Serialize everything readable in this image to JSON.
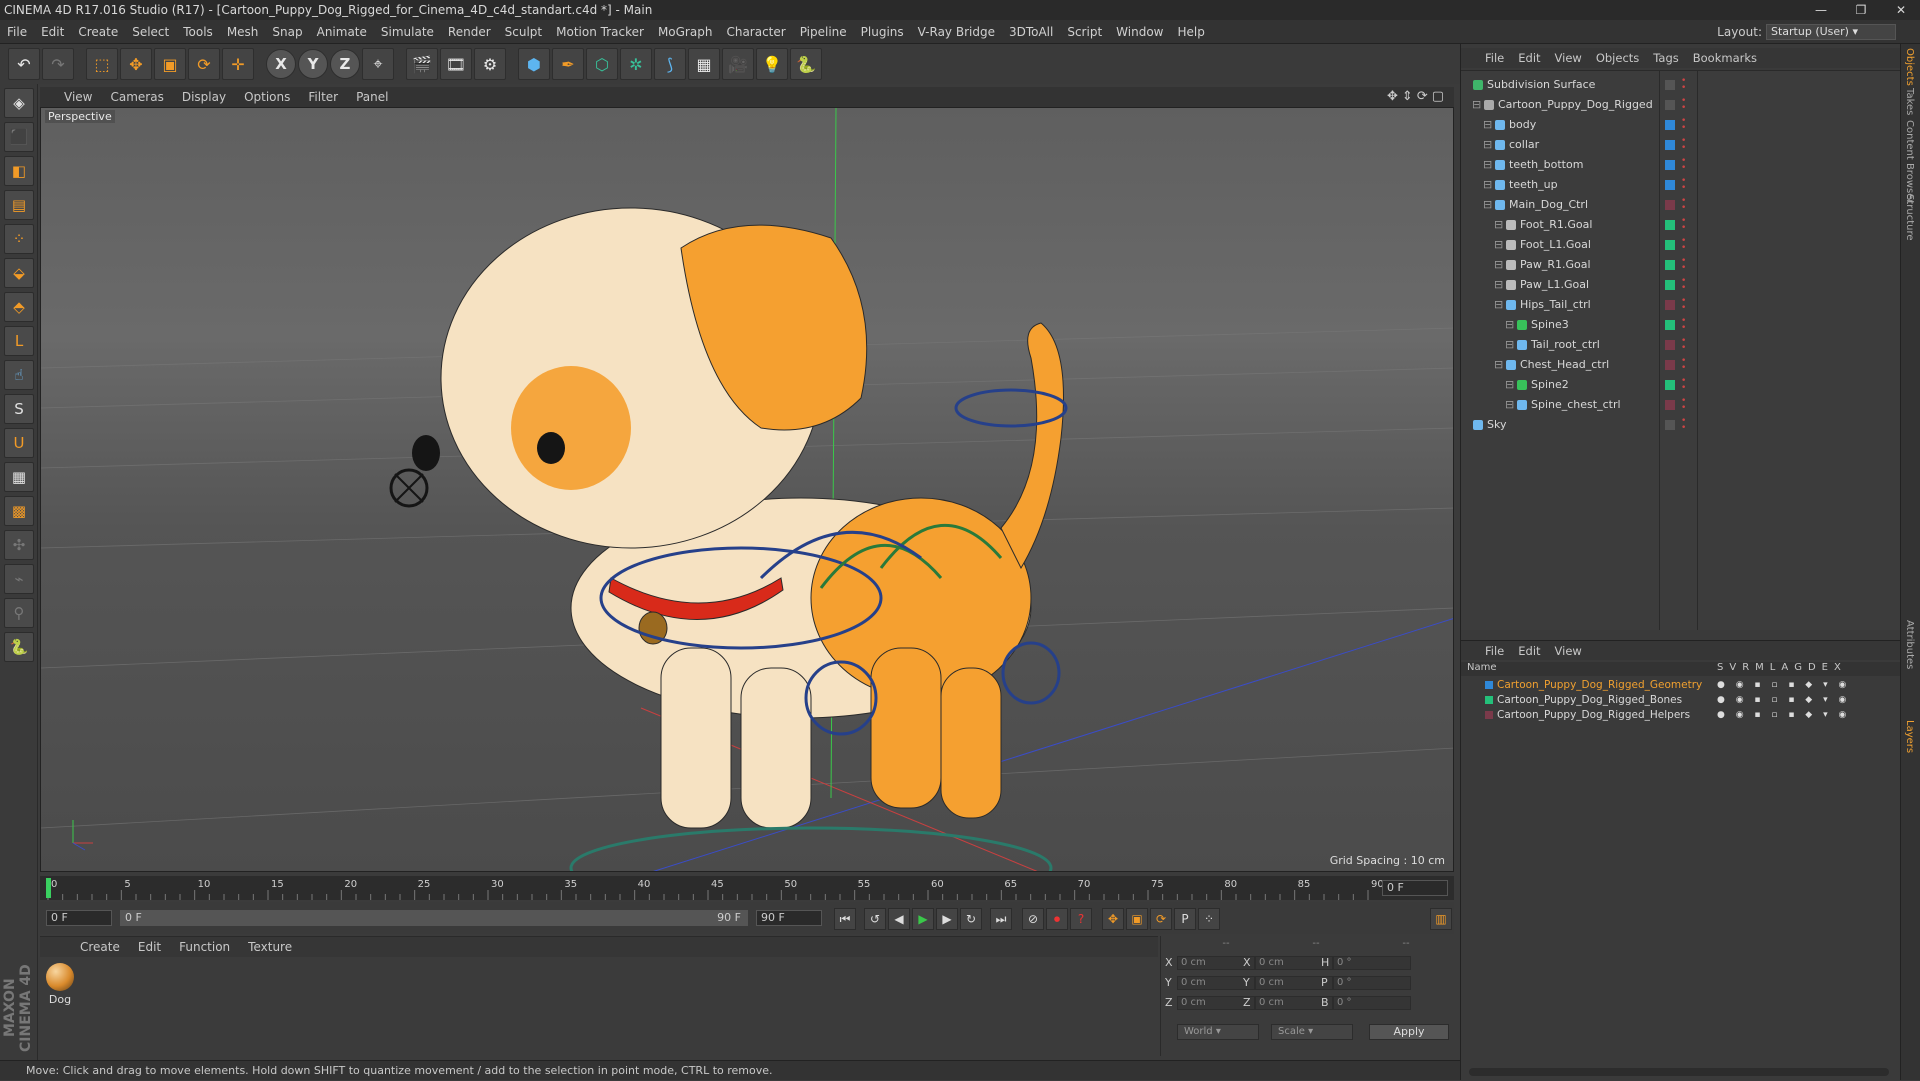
{
  "window": {
    "title": "CINEMA 4D R17.016 Studio (R17) - [Cartoon_Puppy_Dog_Rigged_for_Cinema_4D_c4d_standart.c4d *] - Main"
  },
  "menu": [
    "File",
    "Edit",
    "Create",
    "Select",
    "Tools",
    "Mesh",
    "Snap",
    "Animate",
    "Simulate",
    "Render",
    "Sculpt",
    "Motion Tracker",
    "MoGraph",
    "Character",
    "Pipeline",
    "Plugins",
    "V-Ray Bridge",
    "3DToAll",
    "Script",
    "Window",
    "Help"
  ],
  "layout": {
    "label": "Layout:",
    "value": "Startup (User)"
  },
  "viewport": {
    "menu": [
      "View",
      "Cameras",
      "Display",
      "Options",
      "Filter",
      "Panel"
    ],
    "camera_label": "Perspective",
    "grid_spacing": "Grid Spacing : 10 cm"
  },
  "timeline": {
    "ticks": [
      "0",
      "5",
      "10",
      "15",
      "20",
      "25",
      "30",
      "35",
      "40",
      "45",
      "50",
      "55",
      "60",
      "65",
      "70",
      "75",
      "80",
      "85",
      "90"
    ],
    "current_frame": "0 F",
    "start_frame": "0 F",
    "range_start": "0 F",
    "range_end": "90 F",
    "end_frame": "90 F"
  },
  "material_panel": {
    "menu": [
      "Create",
      "Edit",
      "Function",
      "Texture"
    ],
    "material_name": "Dog"
  },
  "coordinates": {
    "header": [
      "--",
      "--",
      "--"
    ],
    "rows": [
      {
        "a": "X",
        "av": "0 cm",
        "b": "X",
        "bv": "0 cm",
        "c": "H",
        "cv": "0 °"
      },
      {
        "a": "Y",
        "av": "0 cm",
        "b": "Y",
        "bv": "0 cm",
        "c": "P",
        "cv": "0 °"
      },
      {
        "a": "Z",
        "av": "0 cm",
        "b": "Z",
        "bv": "0 cm",
        "c": "B",
        "cv": "0 °"
      }
    ],
    "mode": "World",
    "scale": "Scale",
    "apply": "Apply"
  },
  "status": "Move: Click and drag to move elements. Hold down SHIFT to quantize movement / add to the selection in point mode, CTRL to remove.",
  "object_manager": {
    "menu": [
      "File",
      "Edit",
      "View",
      "Objects",
      "Tags",
      "Bookmarks"
    ],
    "objects": [
      {
        "name": "Subdivision Surface",
        "indent": 0,
        "icon": "#3fb56a",
        "layer": ""
      },
      {
        "name": "Cartoon_Puppy_Dog_Rigged",
        "indent": 1,
        "icon": "#aaaaaa",
        "layer": ""
      },
      {
        "name": "body",
        "indent": 2,
        "icon": "#6fb8ee",
        "layer": "#2f88d8"
      },
      {
        "name": "collar",
        "indent": 2,
        "icon": "#6fb8ee",
        "layer": "#2f88d8"
      },
      {
        "name": "teeth_bottom",
        "indent": 2,
        "icon": "#6fb8ee",
        "layer": "#2f88d8"
      },
      {
        "name": "teeth_up",
        "indent": 2,
        "icon": "#6fb8ee",
        "layer": "#2f88d8"
      },
      {
        "name": "Main_Dog_Ctrl",
        "indent": 2,
        "icon": "#6fb8ee",
        "layer": "#7a3a4a"
      },
      {
        "name": "Foot_R1.Goal",
        "indent": 3,
        "icon": "#bbbbbb",
        "layer": "#24c07a"
      },
      {
        "name": "Foot_L1.Goal",
        "indent": 3,
        "icon": "#bbbbbb",
        "layer": "#24c07a"
      },
      {
        "name": "Paw_R1.Goal",
        "indent": 3,
        "icon": "#bbbbbb",
        "layer": "#24c07a"
      },
      {
        "name": "Paw_L1.Goal",
        "indent": 3,
        "icon": "#bbbbbb",
        "layer": "#24c07a"
      },
      {
        "name": "Hips_Tail_ctrl",
        "indent": 3,
        "icon": "#6fb8ee",
        "layer": "#7a3a4a"
      },
      {
        "name": "Spine3",
        "indent": 4,
        "icon": "#38c25a",
        "layer": "#24c07a"
      },
      {
        "name": "Tail_root_ctrl",
        "indent": 4,
        "icon": "#6fb8ee",
        "layer": "#7a3a4a"
      },
      {
        "name": "Chest_Head_ctrl",
        "indent": 3,
        "icon": "#6fb8ee",
        "layer": "#7a3a4a"
      },
      {
        "name": "Spine2",
        "indent": 4,
        "icon": "#38c25a",
        "layer": "#24c07a"
      },
      {
        "name": "Spine_chest_ctrl",
        "indent": 4,
        "icon": "#6fb8ee",
        "layer": "#7a3a4a"
      },
      {
        "name": "Sky",
        "indent": 0,
        "icon": "#6fb8ee",
        "layer": ""
      }
    ]
  },
  "layer_manager": {
    "menu": [
      "File",
      "Edit",
      "View"
    ],
    "name_header": "Name",
    "columns": [
      "S",
      "V",
      "R",
      "M",
      "L",
      "A",
      "G",
      "D",
      "E",
      "X"
    ],
    "layers": [
      {
        "name": "Cartoon_Puppy_Dog_Rigged_Geometry",
        "color": "#2f88d8",
        "text_color": "#f0a030"
      },
      {
        "name": "Cartoon_Puppy_Dog_Rigged_Bones",
        "color": "#24c07a",
        "text_color": "#d8d8d8"
      },
      {
        "name": "Cartoon_Puppy_Dog_Rigged_Helpers",
        "color": "#7a3a4a",
        "text_color": "#d8d8d8"
      }
    ]
  },
  "side_tabs": [
    "Objects",
    "Takes",
    "Content Browser",
    "Structure",
    "Attributes",
    "Layers"
  ],
  "maxon_logo": "MAXON CINEMA 4D",
  "icons": {
    "toolbar": [
      "undo-icon",
      "redo-icon",
      "select-icon",
      "move-icon",
      "scale-icon",
      "rotate-icon",
      "transform-icon",
      "x-axis-icon",
      "y-axis-icon",
      "z-axis-icon",
      "world-coord-icon",
      "render-view-icon",
      "render-picture-viewer-icon",
      "render-settings-icon",
      "cube-icon",
      "pen-icon",
      "subdivision-icon",
      "array-icon",
      "deformer-icon",
      "floor-icon",
      "camera-icon",
      "light-icon",
      "python-icon"
    ]
  }
}
